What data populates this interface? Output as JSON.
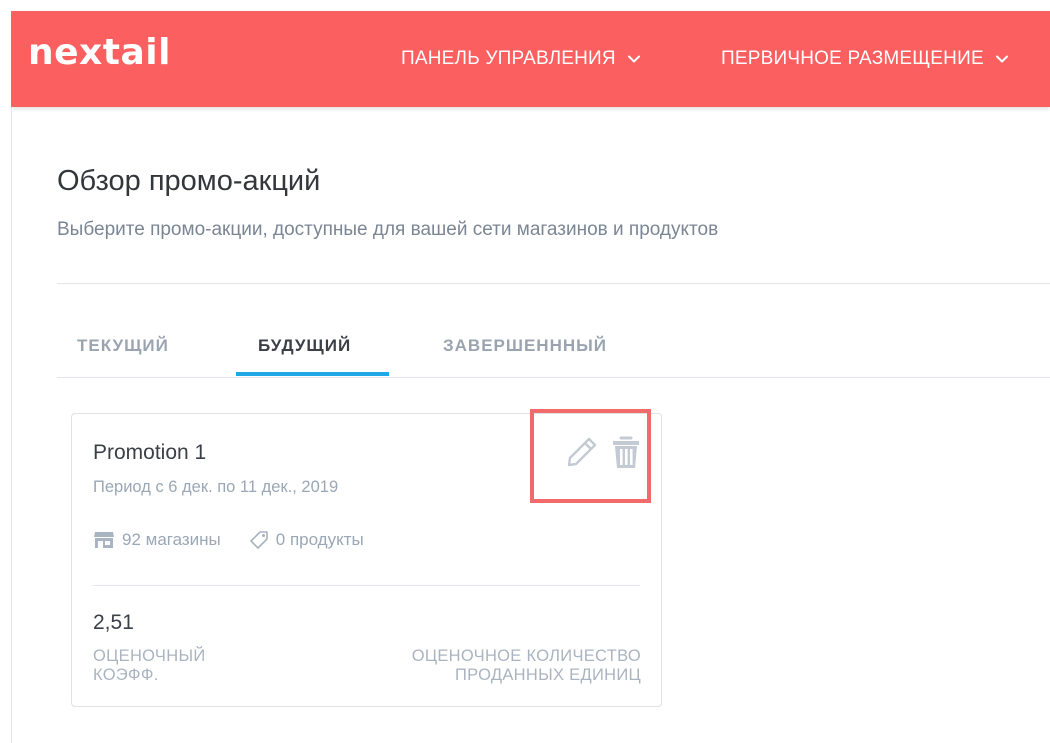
{
  "header": {
    "logo_text": "nextail",
    "brand_color": "#fb5f5f",
    "nav": [
      {
        "label": "ПАНЕЛЬ УПРАВЛЕНИЯ",
        "icon": "chevron-down-icon"
      },
      {
        "label": "ПЕРВИЧНОЕ РАЗМЕЩЕНИЕ",
        "icon": "chevron-down-icon"
      }
    ]
  },
  "page": {
    "title": "Обзор промо-акций",
    "subtitle": "Выберите промо-акции, доступные для вашей сети магазинов и продуктов"
  },
  "tabs": [
    {
      "label": "ТЕКУЩИЙ",
      "active": false
    },
    {
      "label": "БУДУЩИЙ",
      "active": true
    },
    {
      "label": "ЗАВЕРШЕНННЫЙ",
      "active": false
    }
  ],
  "accent_color": "#21a6e6",
  "promo": {
    "name": "Promotion 1",
    "period": "Период с 6 дек. по 11 дек., 2019",
    "stores": "92 магазины",
    "stores_icon": "store-icon",
    "products": "0 продукты",
    "products_icon": "tag-icon",
    "metric_value": "2,51",
    "metric_left_label_line1": "ОЦЕНОЧНЫЙ",
    "metric_left_label_line2": "КОЭФФ.",
    "metric_right_label_line1": "ОЦЕНОЧНОЕ КОЛИЧЕСТВО",
    "metric_right_label_line2": "ПРОДАННЫХ ЕДИНИЦ",
    "actions": [
      {
        "icon": "pencil-icon",
        "purpose": "edit"
      },
      {
        "icon": "trash-icon",
        "purpose": "delete"
      }
    ],
    "highlight_color": "#f26a6a"
  }
}
